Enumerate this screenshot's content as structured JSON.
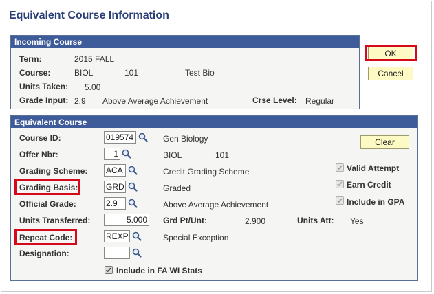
{
  "page": {
    "title": "Equivalent Course Information"
  },
  "buttons": {
    "ok": "OK",
    "cancel": "Cancel",
    "clear": "Clear"
  },
  "incoming": {
    "header": "Incoming Course",
    "term_label": "Term:",
    "term_value": "2015 FALL",
    "course_label": "Course:",
    "course_subject": "BIOL",
    "course_number": "101",
    "course_title": "Test Bio",
    "units_label": "Units Taken:",
    "units_value": "5.00",
    "grade_label": "Grade Input:",
    "grade_value": "2.9",
    "grade_desc": "Above Average Achievement",
    "level_label": "Crse Level:",
    "level_value": "Regular"
  },
  "equivalent": {
    "header": "Equivalent Course",
    "course_id_label": "Course ID:",
    "course_id_value": "019574",
    "course_id_desc": "Gen Biology",
    "offer_label": "Offer Nbr:",
    "offer_value": "1",
    "offer_subject": "BIOL",
    "offer_number": "101",
    "scheme_label": "Grading Scheme:",
    "scheme_value": "ACA",
    "scheme_desc": "Credit Grading Scheme",
    "basis_label": "Grading Basis:",
    "basis_value": "GRD",
    "basis_desc": "Graded",
    "official_label": "Official Grade:",
    "official_value": "2.9",
    "official_desc": "Above Average Achievement",
    "transferred_label": "Units Transferred:",
    "transferred_value": "5.000",
    "gradept_label": "Grd Pt/Unt:",
    "gradept_value": "2.900",
    "units_att_label": "Units Att:",
    "units_att_value": "Yes",
    "repeat_label": "Repeat Code:",
    "repeat_value": "REXP",
    "repeat_desc": "Special Exception",
    "designation_label": "Designation:",
    "designation_value": "",
    "valid_attempt_label": "Valid Attempt",
    "earn_credit_label": "Earn Credit",
    "include_gpa_label": "Include in GPA",
    "include_fa_label": "Include in FA WI Stats"
  },
  "colors": {
    "header_bg": "#3e5c99",
    "button_bg": "#fdfbc3",
    "highlight": "#d40a1a",
    "title": "#2b3f78"
  },
  "icons": {
    "lookup": "magnifier-icon",
    "check": "checkmark-icon"
  }
}
